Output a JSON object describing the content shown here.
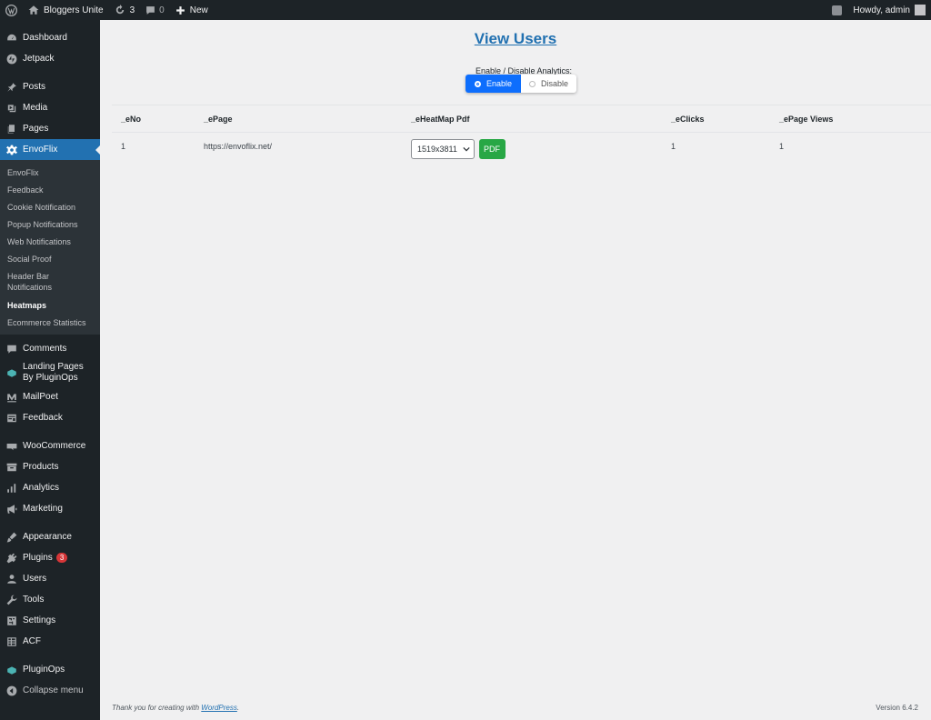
{
  "adminbar": {
    "site_name": "Bloggers Unite",
    "updates_count": "3",
    "comments_count": "0",
    "new_label": "New",
    "howdy": "Howdy, admin"
  },
  "sidebar": {
    "dashboard": "Dashboard",
    "jetpack": "Jetpack",
    "posts": "Posts",
    "media": "Media",
    "pages": "Pages",
    "envoflix": "EnvoFlix",
    "submenu": [
      "EnvoFlix",
      "Feedback",
      "Cookie Notification",
      "Popup Notifications",
      "Web Notifications",
      "Social Proof",
      "Header Bar Notifications",
      "Heatmaps",
      "Ecommerce Statistics"
    ],
    "comments": "Comments",
    "landing_pages": "Landing Pages By PluginOps",
    "mailpoet": "MailPoet",
    "feedback": "Feedback",
    "woocommerce": "WooCommerce",
    "products": "Products",
    "analytics": "Analytics",
    "marketing": "Marketing",
    "appearance": "Appearance",
    "plugins": "Plugins",
    "plugins_badge": "3",
    "users": "Users",
    "tools": "Tools",
    "settings": "Settings",
    "acf": "ACF",
    "pluginops": "PluginOps",
    "collapse": "Collapse menu"
  },
  "main": {
    "title": "View Users",
    "toggle_label": "Enable / Disable Analytics:",
    "enable": "Enable",
    "disable": "Disable",
    "columns": [
      "_eNo",
      "_ePage",
      "_eHeatMap Pdf",
      "_eClicks",
      "_ePage Views"
    ],
    "rows": [
      {
        "no": "1",
        "page": "https://envoflix.net/",
        "size": "1519x3811",
        "pdf": "PDF",
        "clicks": "1",
        "views": "1"
      }
    ]
  },
  "footer": {
    "thanks_prefix": "Thank you for creating with",
    "wordpress": "WordPress",
    "thanks_suffix": ".",
    "version": "Version 6.4.2"
  }
}
